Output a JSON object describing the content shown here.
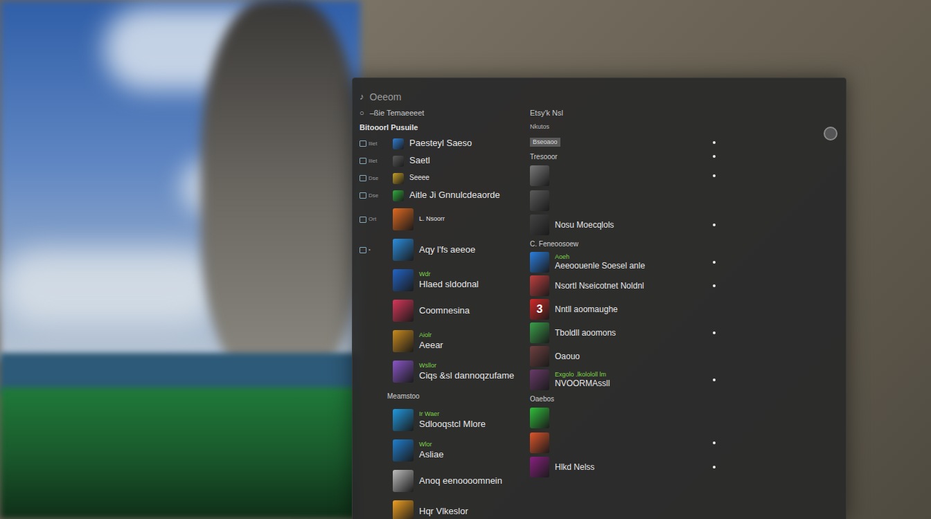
{
  "window": {
    "title": "Oeeom",
    "icon": "♪"
  },
  "header": {
    "icon": "○",
    "left": "–ßie Temaeeeet",
    "right": "Etsy'k Nsl"
  },
  "left": {
    "heading": "Bitooorl Pusuile",
    "items": [
      {
        "kind": "tool",
        "tag": "Iliet",
        "label": "Paesteyl Saeso",
        "color": "#2f7fd6"
      },
      {
        "kind": "tool",
        "tag": "Iliet",
        "label": "Saetl",
        "color": "#5a5a5a"
      },
      {
        "kind": "tool",
        "tag": "Dse",
        "label": "Seeee",
        "color": "#c9a227"
      },
      {
        "kind": "tool",
        "tag": "Dse",
        "label": "Aitle Ji Gnnulcdeaorde",
        "color": "#2fae3c"
      },
      {
        "kind": "app",
        "tag": "Ort",
        "label": "L. Nsoorr",
        "color": "#e06a1f"
      },
      {
        "kind": "app",
        "tag": "•",
        "label": "Aqy l'fs aeeoe",
        "color": "#2a8fe0"
      },
      {
        "kind": "app",
        "sub": "Wdr",
        "label": "Hlaed sldodnal",
        "color": "#2265c7"
      },
      {
        "kind": "app",
        "label": "Coomnesina",
        "color": "#d9365a"
      },
      {
        "kind": "app",
        "sub": "Aiolr",
        "label": "Aeear",
        "color": "#c98a1c"
      },
      {
        "kind": "app",
        "sub": "Wsllor",
        "label": "Ciqs &sl dannoqzufame",
        "color": "#8a56c9"
      },
      {
        "kind": "section",
        "label": "Meamstoo"
      },
      {
        "kind": "app",
        "sub": "Ir Waer",
        "label": "Sdlooqstcl Mlore",
        "color": "#1f9ae0"
      },
      {
        "kind": "app",
        "sub": "Wlor",
        "label": "Asliae",
        "color": "#1f7fd0"
      },
      {
        "kind": "app",
        "label": "Anoq eenoooomnein",
        "color": "#bdbdbd"
      },
      {
        "kind": "app",
        "label": "Hqr Vlkeslor",
        "color": "#f0a020"
      }
    ]
  },
  "right": {
    "heading": "Nkutos",
    "items": [
      {
        "kind": "bar",
        "label": "Bseoaoo",
        "marked": true
      },
      {
        "kind": "text",
        "label": "Tresooor",
        "marked": true
      },
      {
        "kind": "icon",
        "color": "#7a7a7a",
        "marked": true
      },
      {
        "kind": "icon",
        "color": "#5c5c5c",
        "marked": false
      },
      {
        "kind": "app",
        "label": "Nosu Moecqlols",
        "color": "#444444",
        "marked": true
      },
      {
        "kind": "text",
        "label": "C. Feneoosoew",
        "marked": false
      },
      {
        "kind": "app",
        "sub": "Aoeh",
        "label": "Aeeoouenle Soesel anle",
        "color": "#2a7fe0",
        "marked": true
      },
      {
        "kind": "app",
        "label": "Nsortl Nseicotnet Noldnl",
        "color": "#c04040",
        "marked": true
      },
      {
        "kind": "app",
        "glyph": "3",
        "label": "Nntll aoomaughe",
        "color": "#d62828",
        "marked": false
      },
      {
        "kind": "app",
        "label": "Tboldll aoomons",
        "color": "#3aa04a",
        "marked": true
      },
      {
        "kind": "app",
        "label": "Oaouo",
        "color": "#704040",
        "marked": false
      },
      {
        "kind": "app",
        "sub": "Exgolo .lkolololl lm",
        "label": "NVOORMAssll",
        "color": "#6a3a6a",
        "marked": true
      },
      {
        "kind": "text",
        "label": "Oaebos",
        "marked": false
      },
      {
        "kind": "icon",
        "color": "#2fbf3a",
        "marked": false
      },
      {
        "kind": "icon",
        "color": "#e0552a",
        "marked": true
      },
      {
        "kind": "app",
        "label": "Hlkd Nelss",
        "color": "#8a2080",
        "marked": true
      }
    ]
  }
}
